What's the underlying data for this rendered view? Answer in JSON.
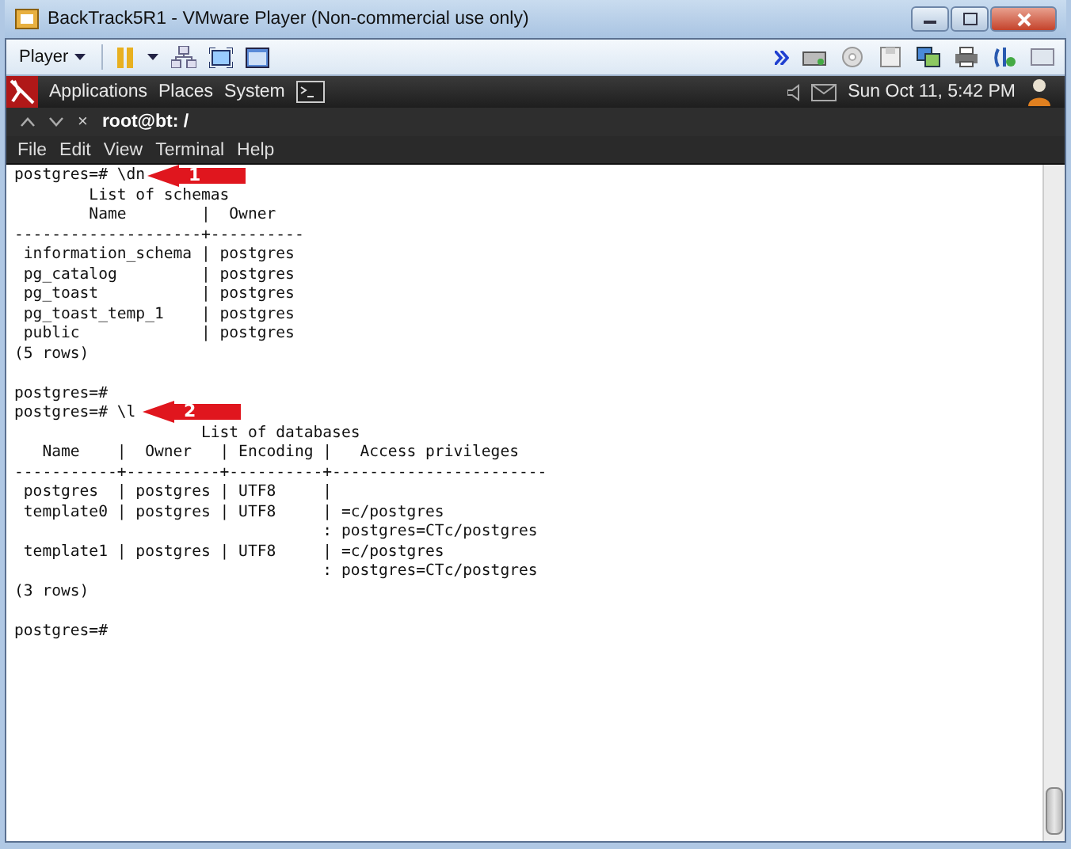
{
  "window": {
    "title": "BackTrack5R1 - VMware Player (Non-commercial use only)"
  },
  "toolbar": {
    "player_menu": "Player"
  },
  "panel": {
    "menus": [
      "Applications",
      "Places",
      "System"
    ],
    "clock": "Sun Oct 11,  5:42 PM"
  },
  "terminal": {
    "title": "root@bt: /",
    "close": "×",
    "menu": [
      "File",
      "Edit",
      "View",
      "Terminal",
      "Help"
    ],
    "blocks": [
      [
        "postgres=# \\dn",
        "        List of schemas",
        "        Name        |  Owner",
        "--------------------+----------",
        " information_schema | postgres",
        " pg_catalog         | postgres",
        " pg_toast           | postgres",
        " pg_toast_temp_1    | postgres",
        " public             | postgres",
        "(5 rows)"
      ],
      [
        "postgres=#",
        "postgres=# \\l",
        "                    List of databases",
        "   Name    |  Owner   | Encoding |   Access privileges",
        "-----------+----------+----------+-----------------------",
        " postgres  | postgres | UTF8     |",
        " template0 | postgres | UTF8     | =c/postgres",
        "                                 : postgres=CTc/postgres",
        " template1 | postgres | UTF8     | =c/postgres",
        "                                 : postgres=CTc/postgres",
        "(3 rows)"
      ],
      [
        "postgres=#"
      ]
    ]
  },
  "callouts": [
    {
      "number": "1"
    },
    {
      "number": "2"
    }
  ]
}
